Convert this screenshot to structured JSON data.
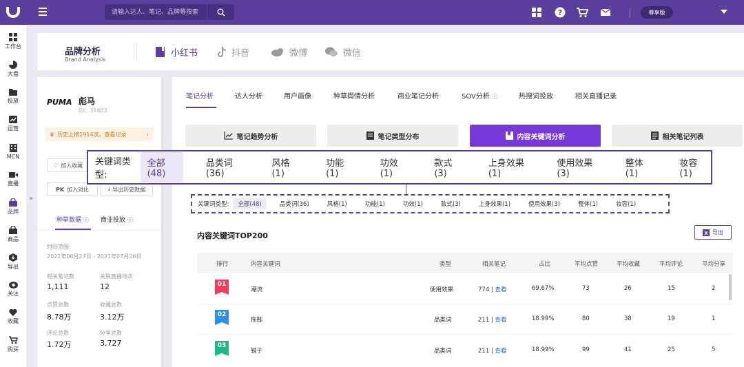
{
  "topbar": {
    "search_placeholder": "请输入达人、笔记、品牌等搜索",
    "vip_label": "尊享版"
  },
  "sidebar": {
    "items": [
      {
        "label": "工作台",
        "icon": "grid-icon"
      },
      {
        "label": "大盘",
        "icon": "pie-chart-icon"
      },
      {
        "label": "投放",
        "icon": "folder-icon"
      },
      {
        "label": "运营",
        "icon": "chart-line-icon"
      },
      {
        "label": "MCN",
        "icon": "building-icon"
      },
      {
        "label": "直播",
        "icon": "video-icon"
      },
      {
        "label": "品牌",
        "icon": "handbag-icon"
      },
      {
        "label": "商品",
        "icon": "bag-icon"
      },
      {
        "label": "导出",
        "icon": "export-icon"
      },
      {
        "label": "关注",
        "icon": "eye-icon"
      },
      {
        "label": "收藏",
        "icon": "heart-icon"
      },
      {
        "label": "购买",
        "icon": "cart-icon"
      }
    ],
    "collapse_label": "»"
  },
  "brand_header": {
    "title": "品牌分析",
    "subtitle": "Brand Analysis",
    "platforms": [
      {
        "label": "小红书",
        "active": true
      },
      {
        "label": "抖音",
        "active": false
      },
      {
        "label": "微博",
        "active": false
      },
      {
        "label": "微信",
        "active": false
      }
    ]
  },
  "brand_panel": {
    "logo_text": "PUMA",
    "name": "彪马",
    "id_text": "ID：31603",
    "history_notice": "历史上榜1914次，查看记录",
    "add_favorite": "加入收藏",
    "pk_label": "PK",
    "add_compare": "加入对比",
    "export_history": "导出历史数据",
    "tabs": [
      "种草数据",
      "商业投放"
    ],
    "time_label": "时间范围:",
    "time_range": "2021年06月27日 - 2021年07月26日",
    "stats": [
      {
        "label": "相关笔记数",
        "value": "1,111"
      },
      {
        "label": "关联直播场次",
        "value": "12"
      },
      {
        "label": "点赞总数",
        "value": "8.78万"
      },
      {
        "label": "收藏总数",
        "value": "3.12万"
      },
      {
        "label": "评论总数",
        "value": "1.72万"
      },
      {
        "label": "分享总数",
        "value": "3,727"
      }
    ]
  },
  "main": {
    "tabs": [
      "笔记分析",
      "达人分析",
      "用户画像",
      "种草舆情分析",
      "商业笔记分析",
      "SOV分析",
      "热搜词投放",
      "相关直播记录"
    ],
    "sub_buttons": [
      "笔记趋势分析",
      "笔记类型分布",
      "内容关键词分析",
      "相关笔记列表"
    ],
    "keyword_type_label": "关键词类型:",
    "keyword_types": [
      "全部(48)",
      "品类词(36)",
      "风格(1)",
      "功能(1)",
      "功效(1)",
      "款式(3)",
      "上身效果(1)",
      "使用效果(3)",
      "整体(1)",
      "妆容(1)"
    ],
    "zoom_label": "关键词类型:",
    "section_title": "内容关键词TOP200",
    "export_label": "导出",
    "table": {
      "columns": [
        "排行",
        "内容关键词",
        "类型",
        "相关笔记",
        "占比",
        "平均点赞",
        "平均收藏",
        "平均评论",
        "平均分享"
      ],
      "view_link": "查看",
      "rows": [
        {
          "rank": "01",
          "keyword": "潮流",
          "type": "使用效果",
          "notes": "774 |",
          "ratio": "69.67%",
          "likes": "73",
          "saves": "26",
          "comments": "15",
          "shares": "2"
        },
        {
          "rank": "02",
          "keyword": "拖鞋",
          "type": "品类词",
          "notes": "211 |",
          "ratio": "18.99%",
          "likes": "80",
          "saves": "38",
          "comments": "19",
          "shares": "1"
        },
        {
          "rank": "03",
          "keyword": "鞋子",
          "type": "品类词",
          "notes": "211 |",
          "ratio": "18.99%",
          "likes": "99",
          "saves": "41",
          "comments": "25",
          "shares": "5"
        }
      ]
    }
  },
  "colors": {
    "primary": "#5b3f9c",
    "active_button": "#7439d6",
    "rank1": "#ee3d5f",
    "rank2": "#2f8fe8",
    "rank3": "#1fb986"
  }
}
